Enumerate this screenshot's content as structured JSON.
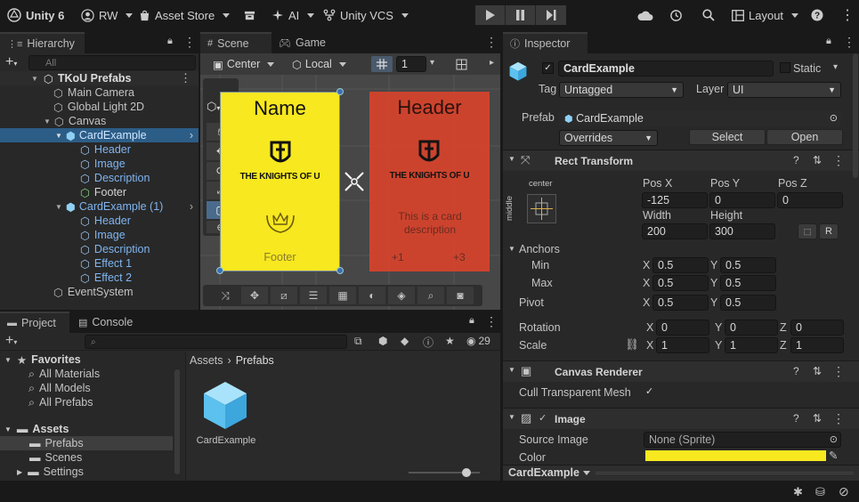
{
  "toolbar": {
    "app_name": "Unity 6",
    "account": "RW",
    "asset_store": "Asset Store",
    "ai": "AI",
    "vcs": "Unity VCS",
    "layout": "Layout"
  },
  "hierarchy": {
    "tab": "Hierarchy",
    "search_placeholder": "All",
    "items": [
      {
        "label": "TKoU Prefabs"
      },
      {
        "label": "Main Camera"
      },
      {
        "label": "Global Light 2D"
      },
      {
        "label": "Canvas"
      },
      {
        "label": "CardExample"
      },
      {
        "label": "Header"
      },
      {
        "label": "Image"
      },
      {
        "label": "Description"
      },
      {
        "label": "Footer"
      },
      {
        "label": "CardExample (1)"
      },
      {
        "label": "Header"
      },
      {
        "label": "Image"
      },
      {
        "label": "Description"
      },
      {
        "label": "Effect 1"
      },
      {
        "label": "Effect 2"
      },
      {
        "label": "EventSystem"
      }
    ]
  },
  "scene": {
    "tab_scene": "Scene",
    "tab_game": "Game",
    "pivot_mode": "Center",
    "space_mode": "Local",
    "grid_value": "1",
    "card1": {
      "title": "Name",
      "brand": "THE KNIGHTS OF U",
      "footer": "Footer",
      "color": "#f7e81f"
    },
    "card2": {
      "title": "Header",
      "brand": "THE KNIGHTS OF U",
      "description": "This is a card description",
      "left_stat": "+1",
      "right_stat": "+3",
      "color": "#d4432c"
    }
  },
  "project": {
    "tab_project": "Project",
    "tab_console": "Console",
    "count": "29",
    "breadcrumb_root": "Assets",
    "breadcrumb_current": "Prefabs",
    "favorites_label": "Favorites",
    "favorites": [
      "All Materials",
      "All Models",
      "All Prefabs"
    ],
    "assets_label": "Assets",
    "folders": [
      "Prefabs",
      "Scenes",
      "Settings"
    ],
    "asset_name": "CardExample"
  },
  "inspector": {
    "tab": "Inspector",
    "object_name": "CardExample",
    "static_label": "Static",
    "tag_label": "Tag",
    "tag_value": "Untagged",
    "layer_label": "Layer",
    "layer_value": "UI",
    "prefab_label": "Prefab",
    "prefab_value": "CardExample",
    "overrides": "Overrides",
    "select": "Select",
    "open": "Open",
    "rect_transform": {
      "title": "Rect Transform",
      "anchor_h": "center",
      "anchor_v": "middle",
      "pos_x_label": "Pos X",
      "pos_x": "-125",
      "pos_y_label": "Pos Y",
      "pos_y": "0",
      "pos_z_label": "Pos Z",
      "pos_z": "0",
      "width_label": "Width",
      "width": "200",
      "height_label": "Height",
      "height": "300",
      "anchors_label": "Anchors",
      "min_label": "Min",
      "min_x": "0.5",
      "min_y": "0.5",
      "max_label": "Max",
      "max_x": "0.5",
      "max_y": "0.5",
      "pivot_label": "Pivot",
      "pivot_x": "0.5",
      "pivot_y": "0.5",
      "rotation_label": "Rotation",
      "rot_x": "0",
      "rot_y": "0",
      "rot_z": "0",
      "scale_label": "Scale",
      "scale_x": "1",
      "scale_y": "1",
      "scale_z": "1",
      "axis_x": "X",
      "axis_y": "Y",
      "axis_z": "Z",
      "button_r": "R"
    },
    "canvas_renderer": {
      "title": "Canvas Renderer",
      "cull_label": "Cull Transparent Mesh"
    },
    "image": {
      "title": "Image",
      "source_label": "Source Image",
      "source_value": "None (Sprite)",
      "color_label": "Color",
      "color_value": "#f7e81f"
    },
    "footer_object": "CardExample"
  }
}
